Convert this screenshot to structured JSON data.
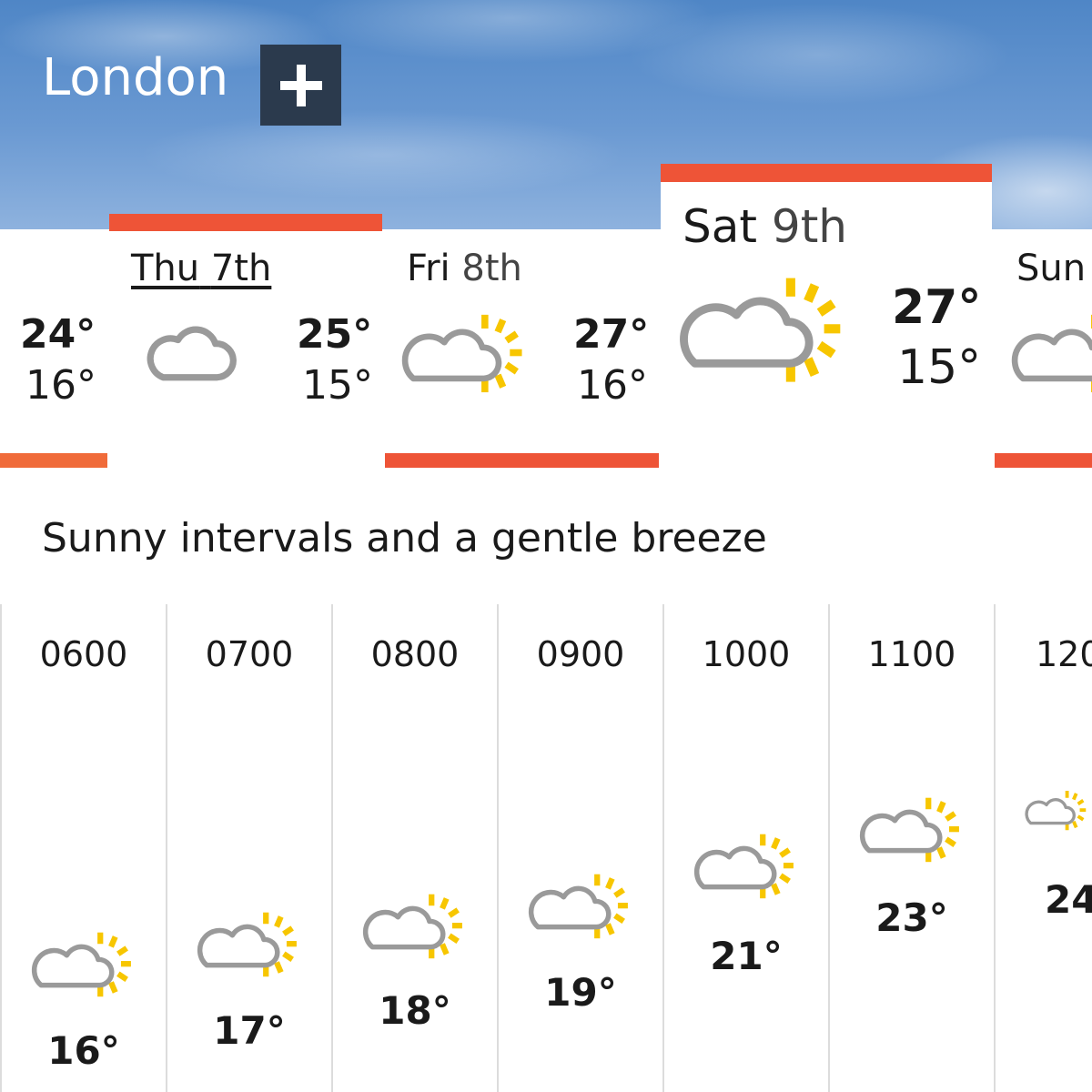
{
  "header": {
    "location": "London",
    "add_label": "+"
  },
  "colors": {
    "accent_bar": "#ee5437",
    "cloud": "#9a9a9a",
    "sun": "#f7c600",
    "add_button_bg": "#2b3a4d"
  },
  "days": [
    {
      "name": "",
      "date": "",
      "high": "24°",
      "low": "16°",
      "icon": "cloud-icon"
    },
    {
      "name": "Thu",
      "date": "7th",
      "high": "25°",
      "low": "15°",
      "icon": "cloud-icon"
    },
    {
      "name": "Fri",
      "date": "8th",
      "high": "27°",
      "low": "16°",
      "icon": "sun-cloud-icon"
    },
    {
      "name": "Sat",
      "date": "9th",
      "high": "27°",
      "low": "15°",
      "icon": "sun-cloud-icon",
      "selected": true
    },
    {
      "name": "Sun",
      "date": "",
      "high": "",
      "low": "",
      "icon": "sun-cloud-icon"
    }
  ],
  "summary": "Sunny intervals and a gentle breeze",
  "hours": [
    {
      "time": "0600",
      "temp": "16°"
    },
    {
      "time": "0700",
      "temp": "17°"
    },
    {
      "time": "0800",
      "temp": "18°"
    },
    {
      "time": "0900",
      "temp": "19°"
    },
    {
      "time": "1000",
      "temp": "21°"
    },
    {
      "time": "1100",
      "temp": "23°"
    },
    {
      "time": "120",
      "temp": "24"
    }
  ]
}
